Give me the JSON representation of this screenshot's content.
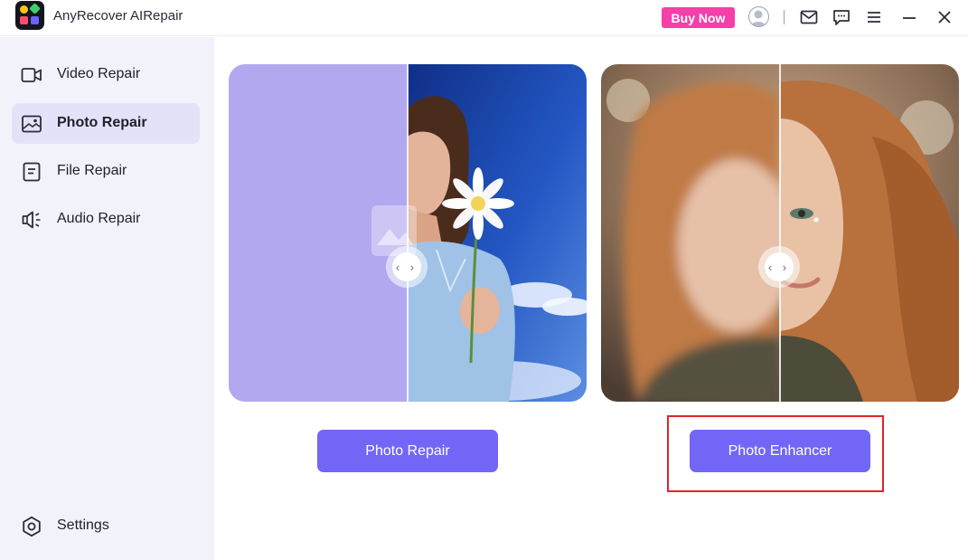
{
  "app": {
    "title": "AnyRecover AIRepair"
  },
  "header": {
    "buy_label": "Buy Now",
    "icons": [
      "avatar-icon",
      "mail-icon",
      "feedback-icon",
      "menu-icon",
      "minimize-icon",
      "close-icon"
    ]
  },
  "sidebar": {
    "items": [
      {
        "label": "Video Repair",
        "icon": "video-icon",
        "active": false
      },
      {
        "label": "Photo Repair",
        "icon": "photo-icon",
        "active": true
      },
      {
        "label": "File Repair",
        "icon": "file-icon",
        "active": false
      },
      {
        "label": "Audio Repair",
        "icon": "audio-icon",
        "active": false
      }
    ],
    "settings_label": "Settings"
  },
  "main": {
    "cards": [
      {
        "name": "photo-repair-preview",
        "handle_icon": "compare-arrows-icon"
      },
      {
        "name": "photo-enhancer-preview",
        "handle_icon": "compare-arrows-icon"
      }
    ],
    "buttons": {
      "photo_repair": "Photo Repair",
      "photo_enhancer": "Photo Enhancer"
    }
  },
  "colors": {
    "accent": "#7266f6",
    "buy": "#f53fa9",
    "sidebar_bg": "#f2f2fb",
    "highlight": "#e0252b"
  }
}
